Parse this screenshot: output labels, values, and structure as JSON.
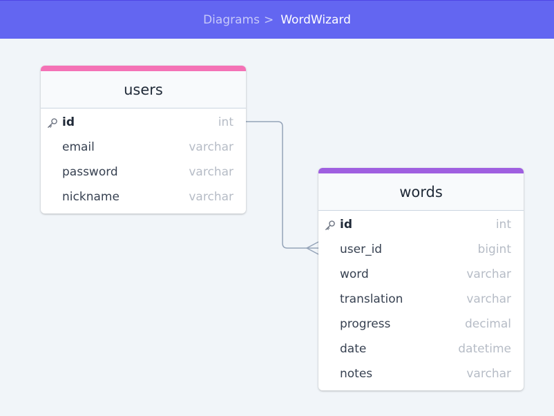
{
  "breadcrumb": {
    "parent": "Diagrams",
    "separator": ">",
    "current": "WordWizard"
  },
  "colors": {
    "topbar": "#6366f1",
    "users_accent": "#f472b6",
    "words_accent": "#9f5fe0",
    "connector": "#94a3b8"
  },
  "tables": {
    "users": {
      "name": "users",
      "fields": [
        {
          "name": "id",
          "type": "int",
          "pk": true
        },
        {
          "name": "email",
          "type": "varchar"
        },
        {
          "name": "password",
          "type": "varchar"
        },
        {
          "name": "nickname",
          "type": "varchar"
        }
      ]
    },
    "words": {
      "name": "words",
      "fields": [
        {
          "name": "id",
          "type": "int",
          "pk": true
        },
        {
          "name": "user_id",
          "type": "bigint"
        },
        {
          "name": "word",
          "type": "varchar"
        },
        {
          "name": "translation",
          "type": "varchar"
        },
        {
          "name": "progress",
          "type": "decimal"
        },
        {
          "name": "date",
          "type": "datetime"
        },
        {
          "name": "notes",
          "type": "varchar"
        }
      ]
    }
  },
  "relationship": {
    "from": "users.id",
    "to": "words.user_id",
    "cardinality": "one-to-many"
  }
}
